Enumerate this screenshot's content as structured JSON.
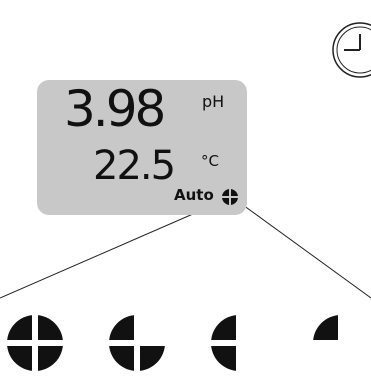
{
  "display": {
    "ph_value": "3.98",
    "ph_unit": "pH",
    "temperature_value": "22.5",
    "temperature_unit": "°C",
    "mode_label": "Auto"
  },
  "icons": {
    "small_status": "quadrant-status-icon",
    "states": [
      "status-icon-4-quarters",
      "status-icon-3-quarters",
      "status-icon-2-quarters",
      "status-icon-1-quarter"
    ],
    "dial": "dial-icon"
  },
  "colors": {
    "display_bg": "#c8c8c8",
    "ink": "#111111"
  }
}
